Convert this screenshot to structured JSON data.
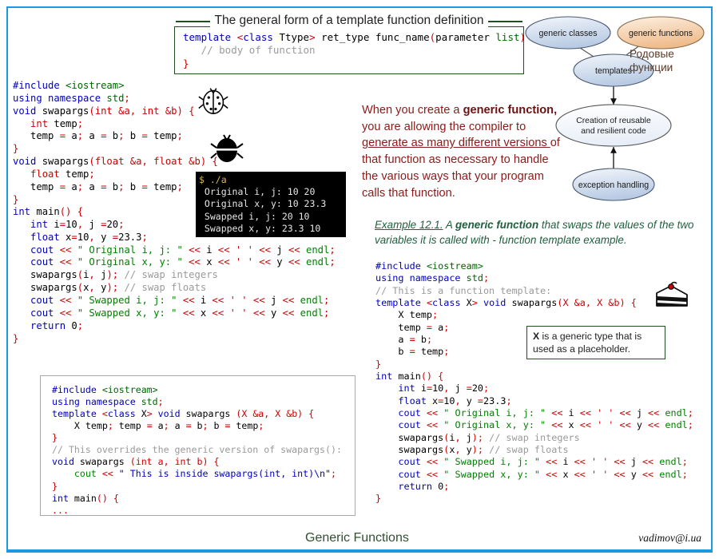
{
  "slide": {
    "footer_title": "Generic Functions",
    "footer_email": "vadimov@i.ua",
    "border_color": "#1b9ae0"
  },
  "top_box": {
    "title": "The general form of a template function definition",
    "code_lines": [
      "template <class Ttype> ret_type func_name(parameter list) {",
      "   // body of function",
      "}"
    ]
  },
  "left_code_top": {
    "lines": [
      "#include <iostream>",
      "using namespace std;",
      "void swapargs(int &a, int &b) {",
      "   int temp;",
      "   temp = a; a = b; b = temp;",
      "}",
      "void swapargs(float &a, float &b) {",
      "   float temp;",
      "   temp = a; a = b; b = temp;",
      "}"
    ]
  },
  "left_code_main": {
    "lines": [
      "int main() {",
      "    int i=10, j =20;",
      "    float x=10, y =23.3;",
      "    cout << \" Original i, j: \" << i << ' ' << j << endl;",
      "    cout << \" Original x, y: \" << x << ' ' << y << endl;",
      "    swapargs(i, j); // swap integers",
      "    swapargs(x, y); // swap floats",
      "    cout << \" Swapped i, j: \" << i << ' ' << j << endl;",
      "    cout << \" Swapped x, y: \" << x << ' ' << y << endl;",
      "    return 0;",
      "}"
    ]
  },
  "terminal": {
    "prompt": "$ ./a",
    "output_lines": [
      " Original i, j: 10 20",
      " Original x, y: 10 23.3",
      " Swapped i, j: 20 10",
      " Swapped x, y: 23.3 10"
    ]
  },
  "right_paragraph": {
    "part1": "When you create a ",
    "bold1": "generic function,",
    "part2": " you are allowing the compiler to ",
    "underline1": "generate as many different versions ",
    "part3": "of that function as necessary to handle the various ways that your program calls that function."
  },
  "example_caption": {
    "number": "Example 12.1.",
    "text_a": " A ",
    "bold": "generic function",
    "text_b": " that swaps the values of the two variables it is called with - function template example."
  },
  "right_code": {
    "lines": [
      "#include <iostream>",
      "using namespace std;",
      "// This is a function template:",
      "template <class X> void swapargs(X &a, X &b) {",
      "    X temp;",
      "    temp = a;",
      "    a = b;",
      "    b = temp;",
      "}",
      "int main() {",
      "    int i=10, j =20;",
      "    float x=10, y =23.3;",
      "    cout << \" Original i, j: \" << i << ' ' << j << endl;",
      "    cout << \" Original x, y: \" << x << ' ' << y << endl;",
      "    swapargs(i, j); // swap integers",
      "    swapargs(x, y); // swap floats",
      "    cout << \" Swapped i, j: \" << i << ' ' << j << endl;",
      "    cout << \" Swapped x, y: \" << x << ' ' << y << endl;",
      "    return 0;",
      "}"
    ]
  },
  "x_callout": {
    "bold": "X",
    "text": " is a generic type that is used as a placeholder."
  },
  "bottom_code_box": {
    "lines": [
      "#include <iostream>",
      "using namespace std;",
      "template <class X> void swapargs (X &a, X &b) {",
      "    X temp; temp = a; a = b; b = temp;",
      "}",
      "// This overrides the generic version of swapargs():",
      "void swapargs (int a, int b) {",
      "    cout << \" This is inside swapargs(int, int)\\n\";",
      "}",
      "int main() {",
      "..."
    ]
  },
  "diagram": {
    "nodes": [
      {
        "id": "generic-classes",
        "label": "generic classes"
      },
      {
        "id": "generic-functions",
        "label": "generic functions"
      },
      {
        "id": "templates",
        "label": "templates"
      },
      {
        "id": "creation",
        "label_line1": "Creation of reusable",
        "label_line2": "and resilient code"
      },
      {
        "id": "exception",
        "label": "exception handling"
      }
    ],
    "russian_line1": "Родовые",
    "russian_line2": "функции",
    "accent_orange": "#f2c99a",
    "accent_blue": "#c6d4e8"
  }
}
